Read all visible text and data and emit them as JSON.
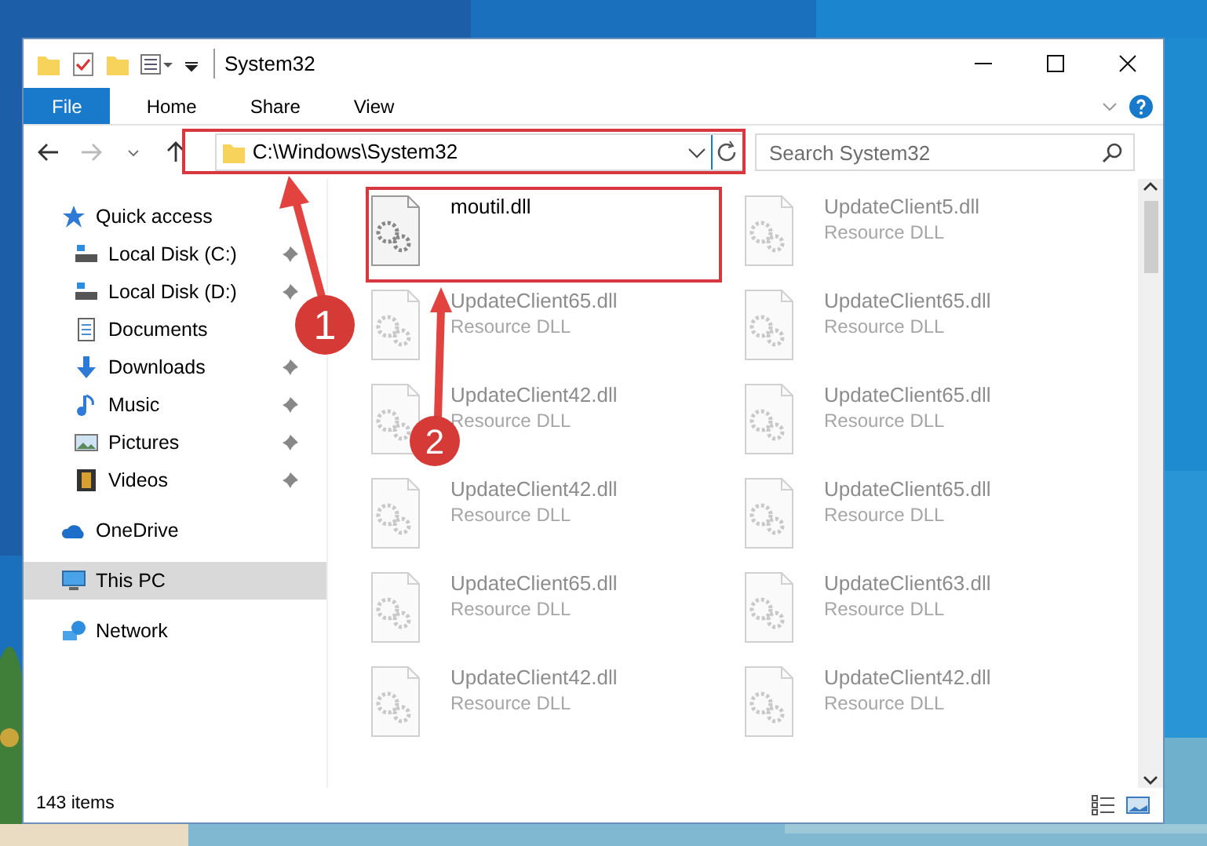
{
  "window": {
    "title": "System32"
  },
  "ribbon_tabs": [
    {
      "label": "File",
      "kind": "file"
    },
    {
      "label": "Home",
      "kind": "tab"
    },
    {
      "label": "Share",
      "kind": "tab"
    },
    {
      "label": "View",
      "kind": "tab"
    }
  ],
  "address_bar": {
    "path": "C:\\Windows\\System32",
    "highlighted": true
  },
  "search": {
    "placeholder": "Search System32"
  },
  "sidebar": {
    "items": [
      {
        "label": "Quick access",
        "kind": "star",
        "selected": false,
        "children": [
          {
            "label": "Local Disk (C:)",
            "kind": "drive",
            "pinned": true,
            "selected": false
          },
          {
            "label": "Local Disk (D:)",
            "kind": "drive",
            "pinned": true,
            "selected": false
          },
          {
            "label": "Documents",
            "kind": "documents",
            "pinned": false,
            "selected": false
          },
          {
            "label": "Downloads",
            "kind": "downloads",
            "pinned": true,
            "selected": false
          },
          {
            "label": "Music",
            "kind": "music",
            "pinned": true,
            "selected": false
          },
          {
            "label": "Pictures",
            "kind": "pictures",
            "pinned": true,
            "selected": false
          },
          {
            "label": "Videos",
            "kind": "videos",
            "pinned": true,
            "selected": false
          }
        ]
      },
      {
        "label": "OneDrive",
        "kind": "cloud",
        "selected": false
      },
      {
        "label": "This PC",
        "kind": "computer",
        "selected": true
      },
      {
        "label": "Network",
        "kind": "network",
        "selected": false
      }
    ]
  },
  "files": [
    {
      "name": "moutil.dll",
      "blurred": false,
      "highlighted": true
    },
    {
      "name": "UpdateClient5.dll",
      "type": "Resource DLL",
      "blurred": true,
      "highlighted": false
    },
    {
      "name": "UpdateClient65.dll",
      "type": "Resource DLL",
      "blurred": true,
      "highlighted": false
    },
    {
      "name": "UpdateClient65.dll",
      "type": "Resource DLL",
      "blurred": true,
      "highlighted": false
    },
    {
      "name": "UpdateClient42.dll",
      "type": "Resource DLL",
      "blurred": true,
      "highlighted": false
    },
    {
      "name": "UpdateClient65.dll",
      "type": "Resource DLL",
      "blurred": true,
      "highlighted": false
    },
    {
      "name": "UpdateClient42.dll",
      "type": "Resource DLL",
      "blurred": true,
      "highlighted": false
    },
    {
      "name": "UpdateClient65.dll",
      "type": "Resource DLL",
      "blurred": true,
      "highlighted": false
    },
    {
      "name": "UpdateClient65.dll",
      "type": "Resource DLL",
      "blurred": true,
      "highlighted": false
    },
    {
      "name": "UpdateClient63.dll",
      "type": "Resource DLL",
      "blurred": true,
      "highlighted": false
    },
    {
      "name": "UpdateClient42.dll",
      "type": "Resource DLL",
      "blurred": true,
      "highlighted": false
    },
    {
      "name": "UpdateClient42.dll",
      "type": "Resource DLL",
      "blurred": true,
      "highlighted": false
    }
  ],
  "status_bar": {
    "count": "143 items"
  },
  "annotations": [
    {
      "label": "1"
    },
    {
      "label": "2"
    }
  ]
}
